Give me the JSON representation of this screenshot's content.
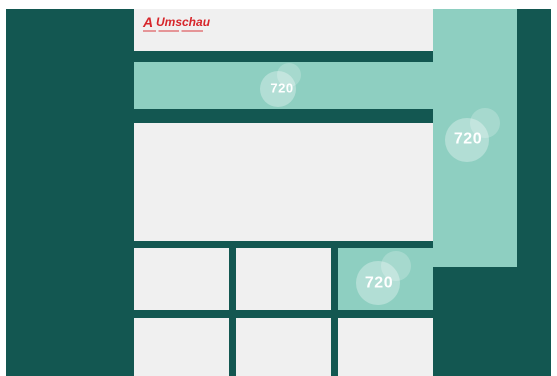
{
  "logo": {
    "mark": "A",
    "name": "Umschau"
  },
  "ads": {
    "banner_label": "720",
    "skyscraper_label": "720",
    "grid_label": "720"
  },
  "colors": {
    "background": "#135751",
    "placeholder": "#f0f0f0",
    "ad_fill": "#8ecfc1",
    "brand_red": "#d7262b"
  }
}
